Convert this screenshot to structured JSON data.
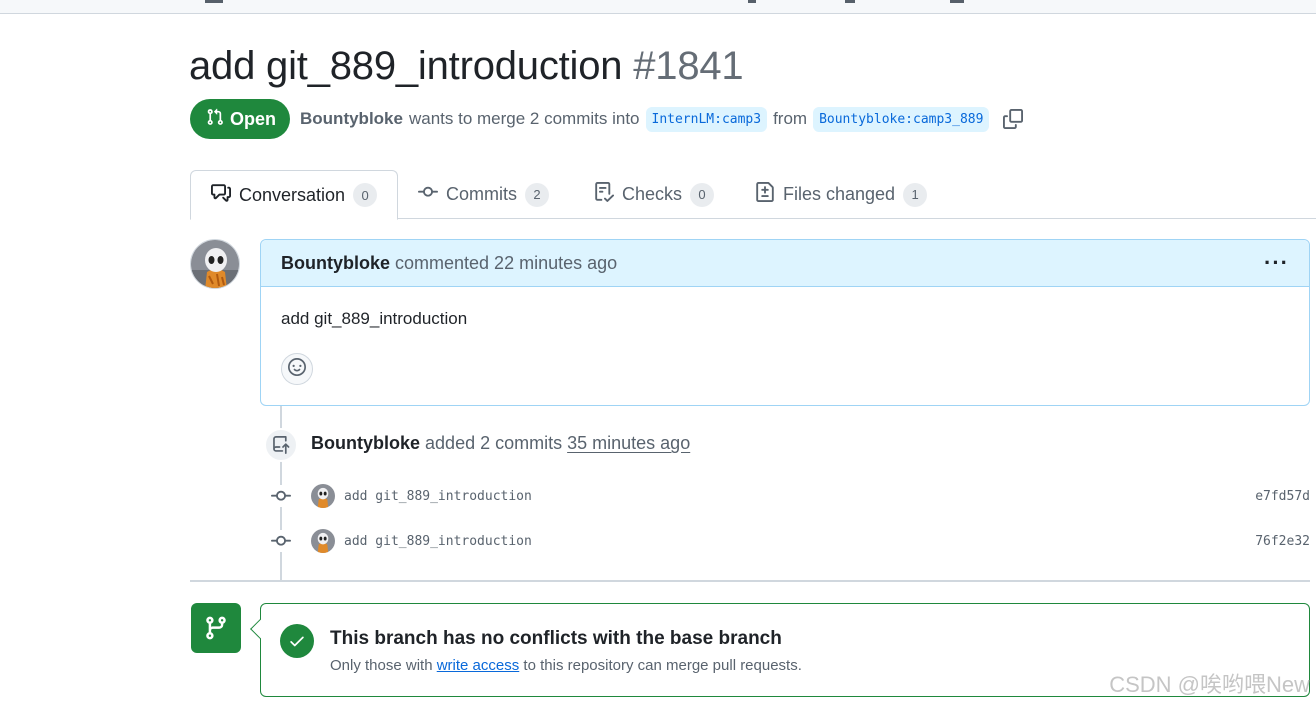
{
  "pr": {
    "title": "add git_889_introduction",
    "number": "#1841",
    "state": "Open",
    "author": "Bountybloke",
    "merge_text": "wants to merge 2 commits into",
    "base_branch": "InternLM:camp3",
    "from_text": "from",
    "head_branch": "Bountybloke:camp3_889"
  },
  "tabs": [
    {
      "label": "Conversation",
      "count": "0"
    },
    {
      "label": "Commits",
      "count": "2"
    },
    {
      "label": "Checks",
      "count": "0"
    },
    {
      "label": "Files changed",
      "count": "1"
    }
  ],
  "comment": {
    "author": "Bountybloke",
    "action": "commented 22 minutes ago",
    "body": "add git_889_introduction"
  },
  "commit_event": {
    "author": "Bountybloke",
    "action": "added 2 commits",
    "time": "35 minutes ago"
  },
  "commits": [
    {
      "message": "add git_889_introduction",
      "sha": "e7fd57d"
    },
    {
      "message": "add git_889_introduction",
      "sha": "76f2e32"
    }
  ],
  "merge": {
    "title": "This branch has no conflicts with the base branch",
    "sub_before": "Only those with",
    "sub_link": "write access",
    "sub_after": "to this repository can merge pull requests."
  },
  "watermark": "CSDN @唉哟喂New",
  "colors": {
    "success": "#1f883d",
    "accent": "#0969da",
    "comment_header": "#ddf4ff"
  }
}
